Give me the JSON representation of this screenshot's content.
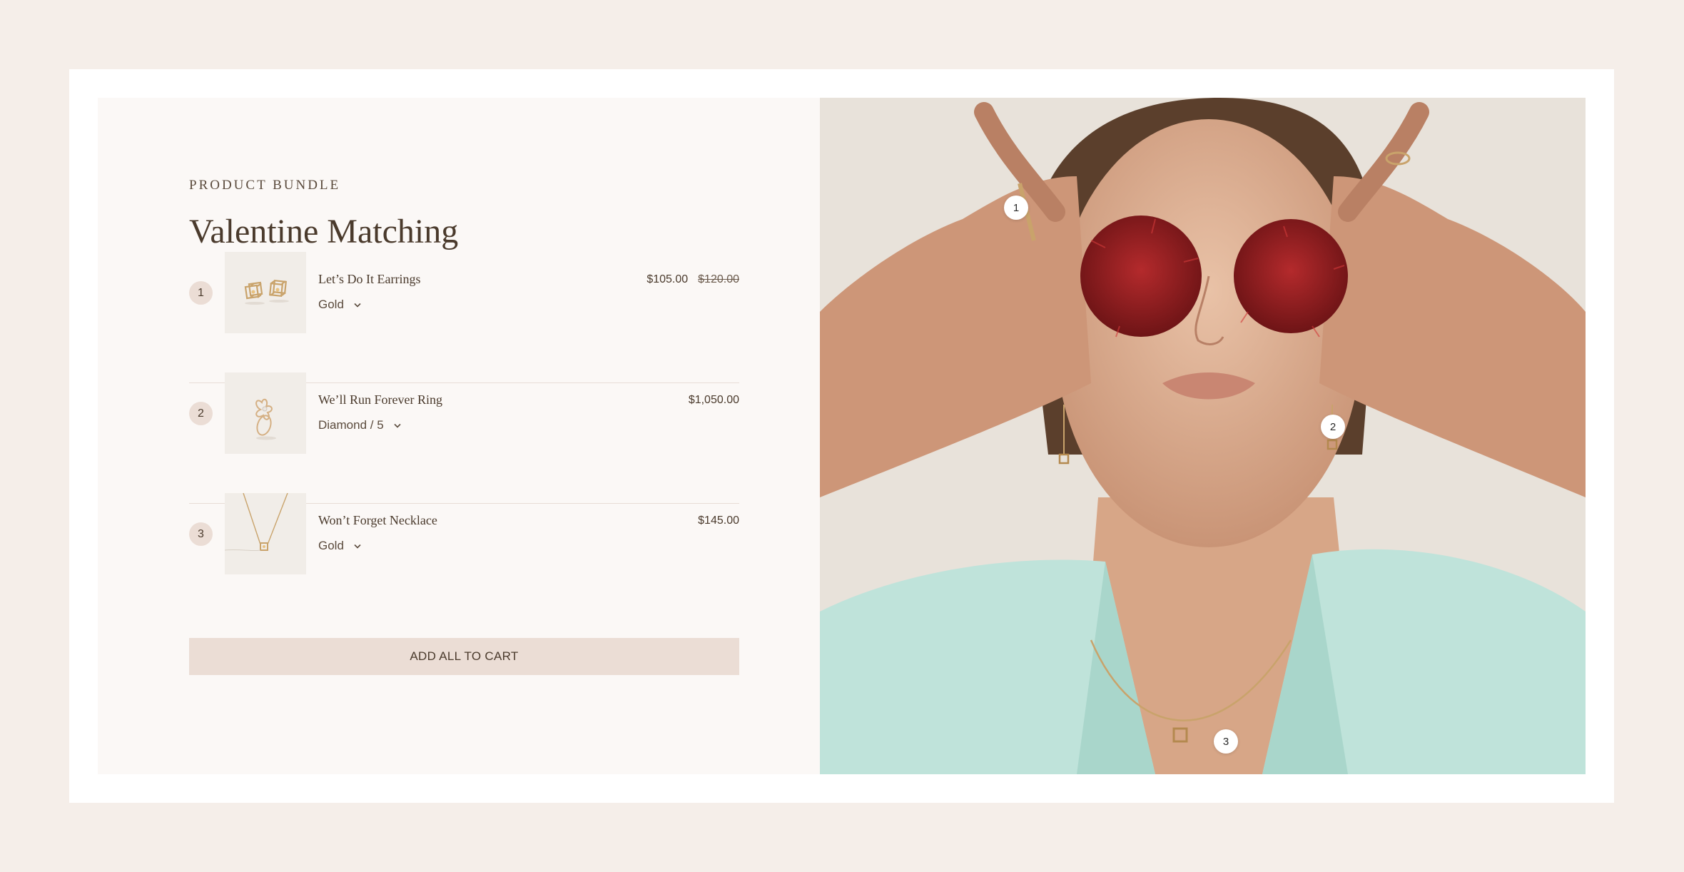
{
  "bundle": {
    "eyebrow": "PRODUCT BUNDLE",
    "title": "Valentine Matching",
    "items": [
      {
        "number": "1",
        "name": "Let’s Do It Earrings",
        "variant": "Gold",
        "price": "$105.00",
        "compare_price": "$120.00",
        "thumb_icon": "earrings-thumbnail"
      },
      {
        "number": "2",
        "name": "We’ll Run Forever Ring",
        "variant": "Diamond / 5",
        "price": "$1,050.00",
        "compare_price": "",
        "thumb_icon": "ring-thumbnail"
      },
      {
        "number": "3",
        "name": "Won’t Forget Necklace",
        "variant": "Gold",
        "price": "$145.00",
        "compare_price": "",
        "thumb_icon": "necklace-thumbnail"
      }
    ],
    "cta_label": "ADD ALL TO CART"
  },
  "photo": {
    "hotspots": [
      "1",
      "2",
      "3"
    ]
  },
  "colors": {
    "page_background": "#f5eee9",
    "panel_background": "#fbf8f6",
    "accent": "#ebddd5",
    "text": "#4a3a2c",
    "gold": "#c9a36b",
    "jacket": "#bfe3da"
  }
}
